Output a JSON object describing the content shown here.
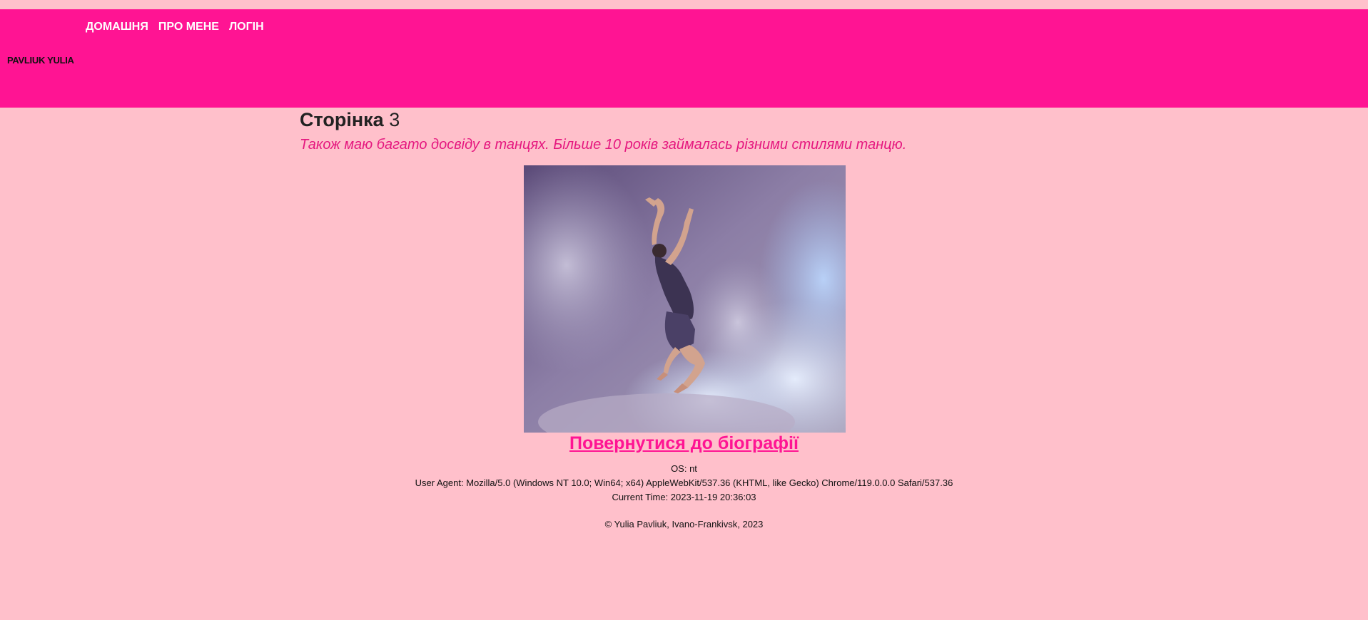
{
  "header": {
    "nav": [
      "ДОМАШНЯ",
      "ПРО МЕНЕ",
      "ЛОГІН"
    ],
    "site_name": "PAVLIUK YULIA",
    "background": "#ff1493"
  },
  "main": {
    "title_bold": "Сторінка",
    "title_number": "3",
    "subtitle": "Також маю багато досвіду в танцях. Більше 10 років займалась різними стилями танцю.",
    "image": "dancer-photo",
    "back_link": "Повернутися до біографії"
  },
  "info": {
    "os": "OS: nt",
    "user_agent": "User Agent: Mozilla/5.0 (Windows NT 10.0; Win64; x64) AppleWebKit/537.36 (KHTML, like Gecko) Chrome/119.0.0.0 Safari/537.36",
    "current_time": "Current Time: 2023-11-19 20:36:03"
  },
  "footer": {
    "copyright": "© Yulia Pavliuk, Ivano-Frankivsk, 2023"
  },
  "colors": {
    "page_background": "#ffc0cb",
    "accent": "#ff1493"
  }
}
